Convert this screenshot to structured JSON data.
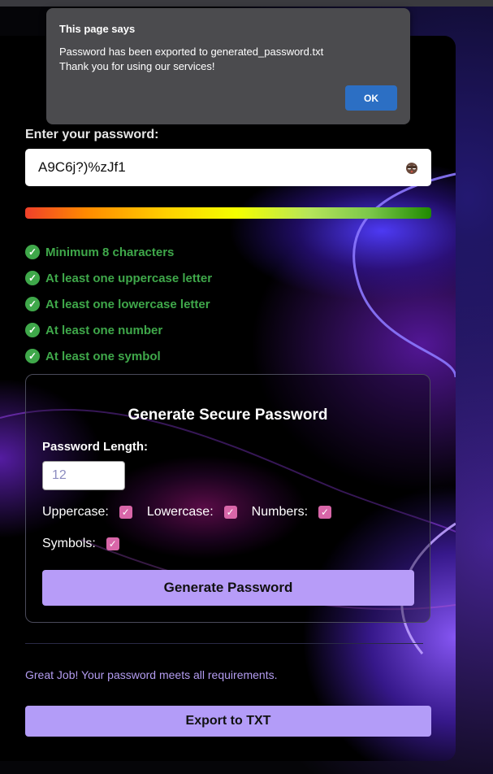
{
  "dialog": {
    "title": "This page says",
    "message_line1": "Password has been exported to generated_password.txt",
    "message_line2": "Thank you for using our services!",
    "ok_label": "OK"
  },
  "checker": {
    "label": "Enter your password:",
    "password_value": "A9C6j?)%zJf1",
    "eye_icon": "eye-hidden-icon",
    "strength_fraction": 1.0,
    "requirements": [
      {
        "text": "Minimum 8 characters",
        "met": true
      },
      {
        "text": "At least one uppercase letter",
        "met": true
      },
      {
        "text": "At least one lowercase letter",
        "met": true
      },
      {
        "text": "At least one number",
        "met": true
      },
      {
        "text": "At least one symbol",
        "met": true
      }
    ]
  },
  "generator": {
    "title": "Generate Secure Password",
    "length_label": "Password Length:",
    "length_placeholder": "12",
    "options": [
      {
        "label": "Uppercase:",
        "checked": true
      },
      {
        "label": "Lowercase:",
        "checked": true
      },
      {
        "label": "Numbers:",
        "checked": true
      },
      {
        "label": "Symbols:",
        "checked": true
      }
    ],
    "generate_label": "Generate Password"
  },
  "result_message": "Great Job! Your password meets all requirements.",
  "export_label": "Export to TXT",
  "colors": {
    "requirement_green": "#3fa84a",
    "button_purple": "#b79cf8",
    "checkbox_pink": "#d866a8",
    "ok_blue": "#2c6fc4"
  }
}
